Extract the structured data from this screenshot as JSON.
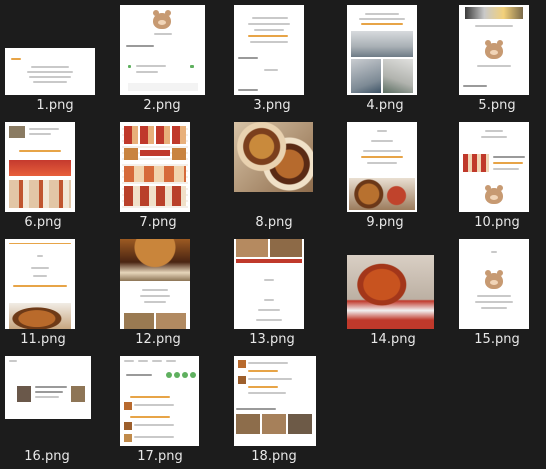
{
  "files": [
    {
      "name": "1.png"
    },
    {
      "name": "2.png"
    },
    {
      "name": "3.png"
    },
    {
      "name": "4.png"
    },
    {
      "name": "5.png"
    },
    {
      "name": "6.png"
    },
    {
      "name": "7.png"
    },
    {
      "name": "8.png"
    },
    {
      "name": "9.png"
    },
    {
      "name": "10.png"
    },
    {
      "name": "11.png"
    },
    {
      "name": "12.png"
    },
    {
      "name": "13.png"
    },
    {
      "name": "14.png"
    },
    {
      "name": "15.png"
    },
    {
      "name": "16.png"
    },
    {
      "name": "17.png"
    },
    {
      "name": "18.png"
    }
  ],
  "colors": {
    "background": "#1c1c1c",
    "label": "#e8e8e8",
    "thumb_bg": "#ffffff",
    "accent_orange": "#e7a447",
    "accent_green": "#5fb05f",
    "bear": "#c79a72"
  }
}
